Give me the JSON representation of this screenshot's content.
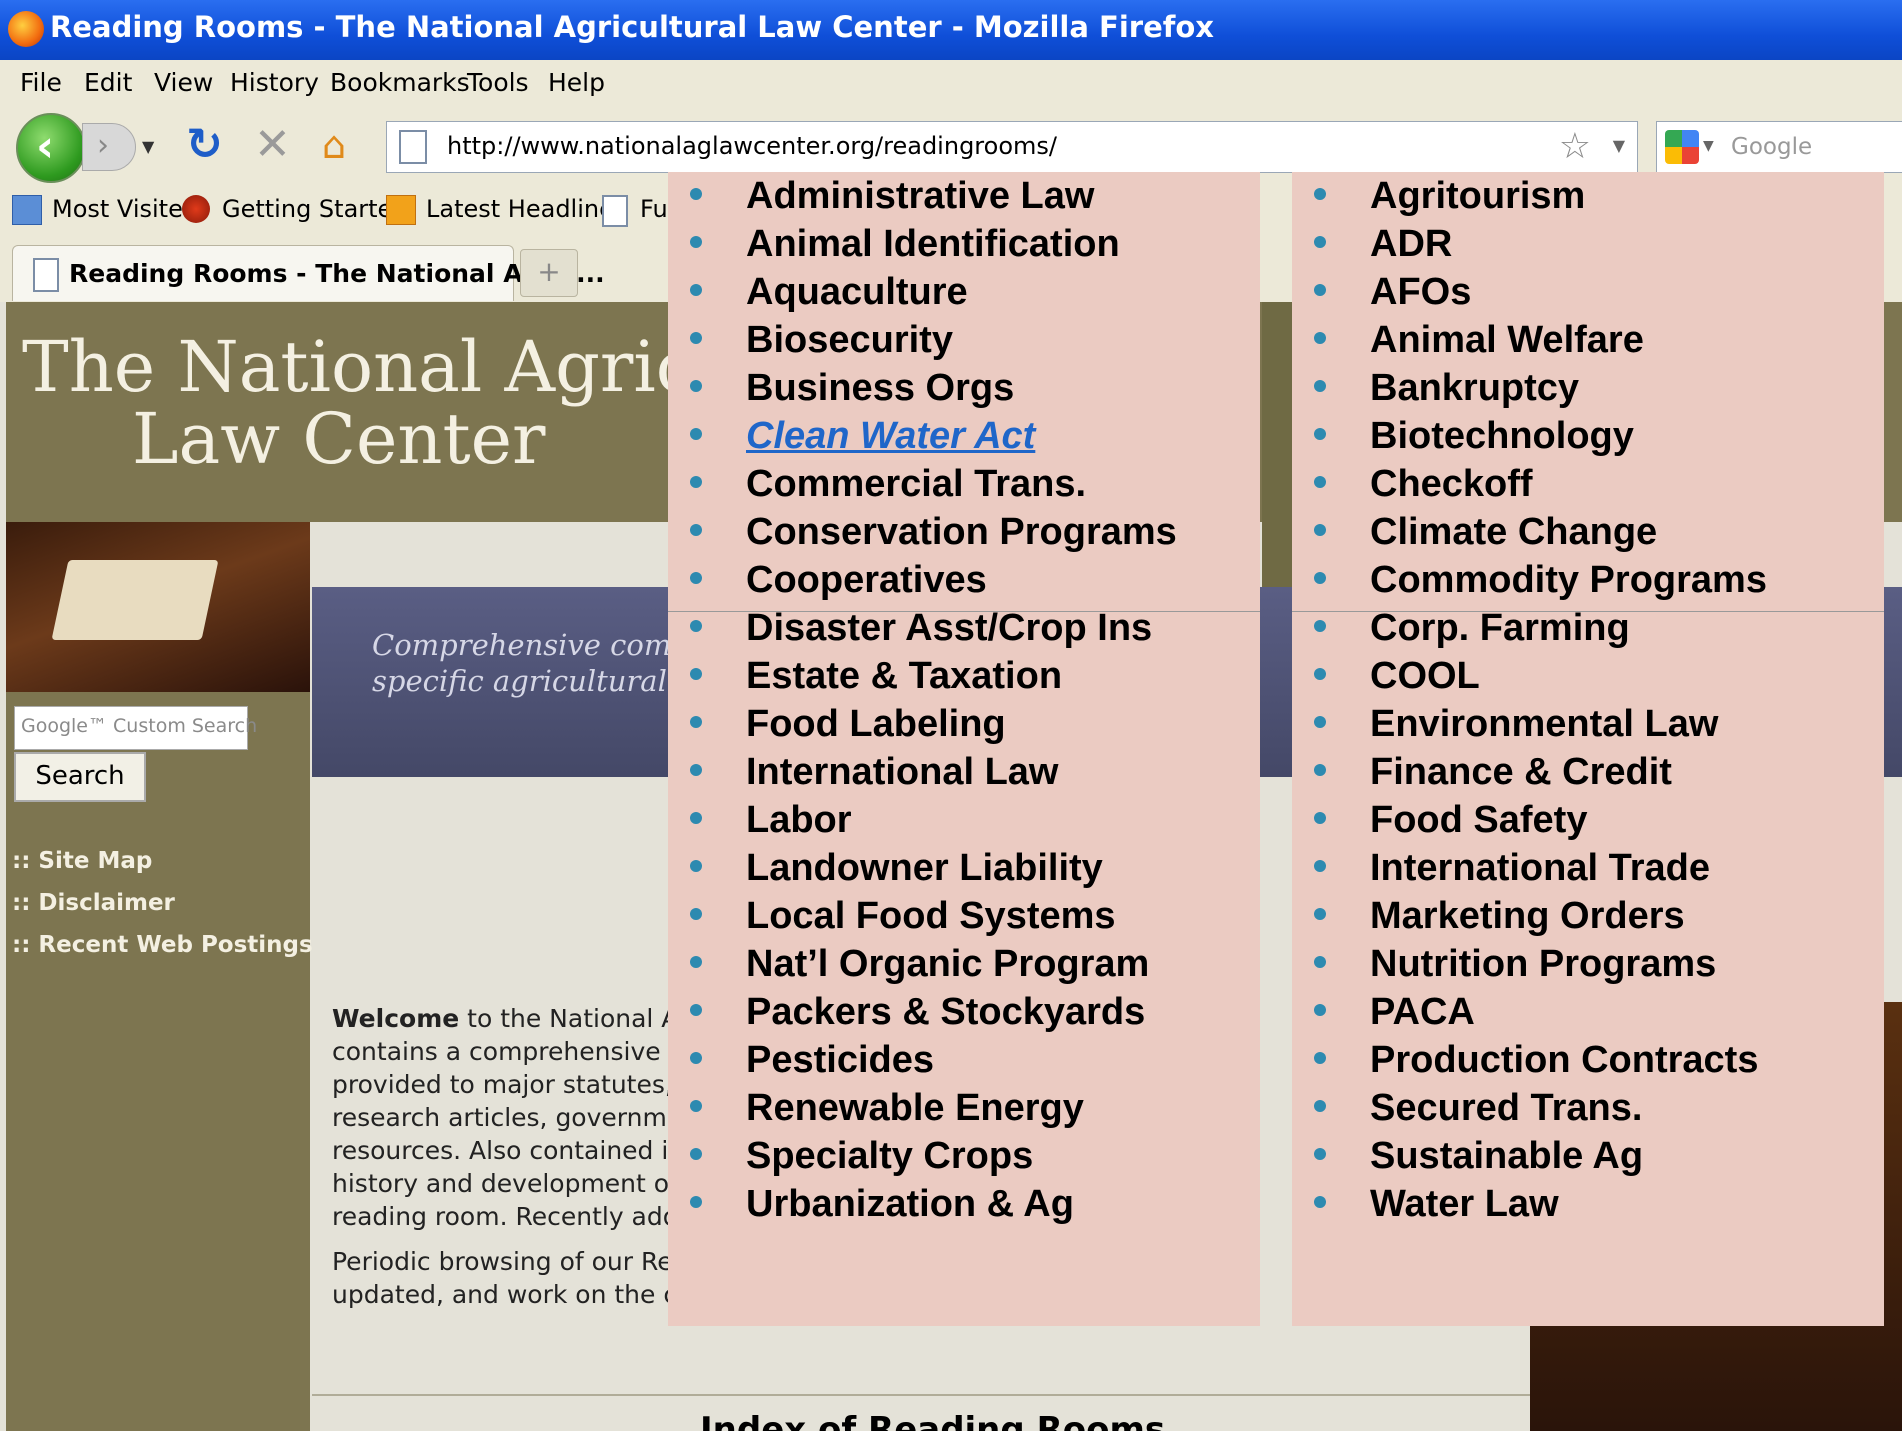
{
  "window": {
    "title": "Reading Rooms - The National Agricultural Law Center - Mozilla Firefox"
  },
  "menu": [
    "File",
    "Edit",
    "View",
    "History",
    "Bookmarks",
    "Tools",
    "Help"
  ],
  "nav": {
    "url": "http://www.nationalaglawcenter.org/readingrooms/",
    "search_placeholder": "Google"
  },
  "bookmarks": [
    "Most Visited",
    "Getting Started",
    "Latest Headlines",
    "Ful"
  ],
  "tabs": [
    {
      "label": "Reading Rooms - The National Agric...",
      "active": true
    }
  ],
  "site": {
    "logo_line1": "The National Agricultural",
    "logo_line2": "Law Center",
    "banner_line1": "Comprehensive compi",
    "banner_line2": "specific agricultural ar",
    "custom_search_placeholder": "Google™ Custom Search",
    "search_button": "Search",
    "links": [
      ":: Site Map",
      ":: Disclaimer",
      ":: Recent Web Postings"
    ],
    "welcome_bold": "Welcome",
    "welcome_lines": [
      " to the National AgLa",
      "contains a comprehensive list",
      "provided to major statutes, reg",
      "research articles, government",
      "resources. Also contained in e",
      "history and development of tha",
      "reading room. Recently added"
    ],
    "periodic_lines": [
      "Periodic browsing of our Read",
      "updated, and work on the cons"
    ],
    "index_heading": "Index of Reading Rooms"
  },
  "topics": {
    "column1": [
      "Administrative Law",
      "Animal Identification",
      "Aquaculture",
      "Biosecurity",
      "Business Orgs",
      "Clean Water Act",
      "Commercial Trans.",
      "Conservation Programs",
      "Cooperatives",
      "Disaster Asst/Crop Ins",
      "Estate & Taxation",
      "Food Labeling",
      "International Law",
      "Labor",
      "Landowner Liability",
      "Local Food Systems",
      "Nat’l Organic Program",
      "Packers & Stockyards",
      "Pesticides",
      "Renewable Energy",
      "Specialty Crops",
      "Urbanization & Ag"
    ],
    "column2": [
      "Agritourism",
      "ADR",
      "AFOs",
      "Animal Welfare",
      "Bankruptcy",
      "Biotechnology",
      "Checkoff",
      "Climate Change",
      "Commodity Programs",
      "Corp. Farming",
      "COOL",
      "Environmental Law",
      "Finance & Credit",
      "Food Safety",
      "International Trade",
      "Marketing Orders",
      "Nutrition Programs",
      "PACA",
      "Production Contracts",
      "Secured Trans.",
      "Sustainable Ag",
      "Water Law"
    ],
    "highlighted_link": "Clean Water Act",
    "link_color": "#1f66c9",
    "panel_color": "#ebcbc2",
    "bullet_color": "#2d8ab0"
  }
}
